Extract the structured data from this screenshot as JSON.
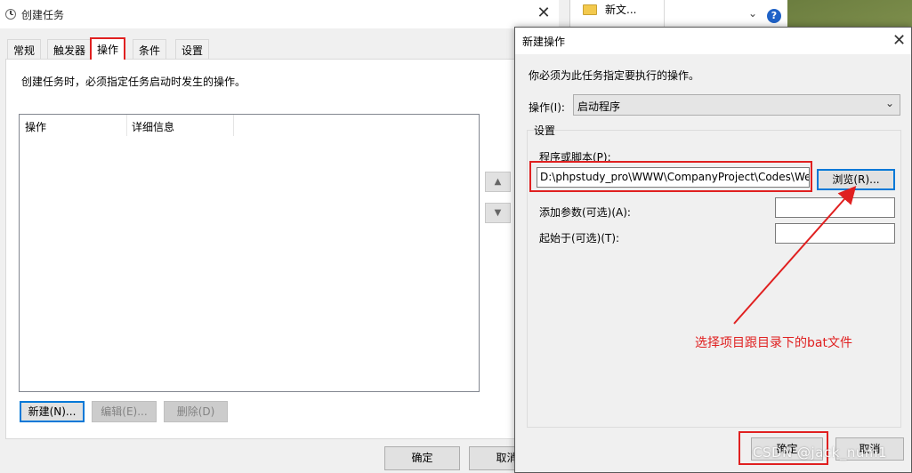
{
  "main_window": {
    "title": "创建任务",
    "tabs": [
      "常规",
      "触发器",
      "操作",
      "条件",
      "设置"
    ],
    "active_tab": "操作",
    "instruction": "创建任务时，必须指定任务启动时发生的操作。",
    "columns": [
      "操作",
      "详细信息"
    ],
    "buttons": {
      "new": "新建(N)...",
      "edit": "编辑(E)...",
      "delete": "删除(D)"
    },
    "footer": {
      "ok": "确定",
      "cancel": "取消"
    }
  },
  "explorer": {
    "item_label": "新文...",
    "chevron": "⌄",
    "help": "?"
  },
  "dialog": {
    "title": "新建操作",
    "intro": "你必须为此任务指定要执行的操作。",
    "action_label": "操作(I):",
    "action_value": "启动程序",
    "settings_label": "设置",
    "program_label": "程序或脚本(P):",
    "program_value": "D:\\phpstudy_pro\\WWW\\CompanyProject\\Codes\\We",
    "browse": "浏览(R)...",
    "args_label": "添加参数(可选)(A):",
    "start_label": "起始于(可选)(T):",
    "ok": "确定",
    "cancel": "取消"
  },
  "annotation": "选择项目跟目录下的bat文件",
  "watermark": "CSDN @jack_num1",
  "colors": {
    "highlight_red": "#e02020",
    "focus_blue": "#0078d7"
  }
}
